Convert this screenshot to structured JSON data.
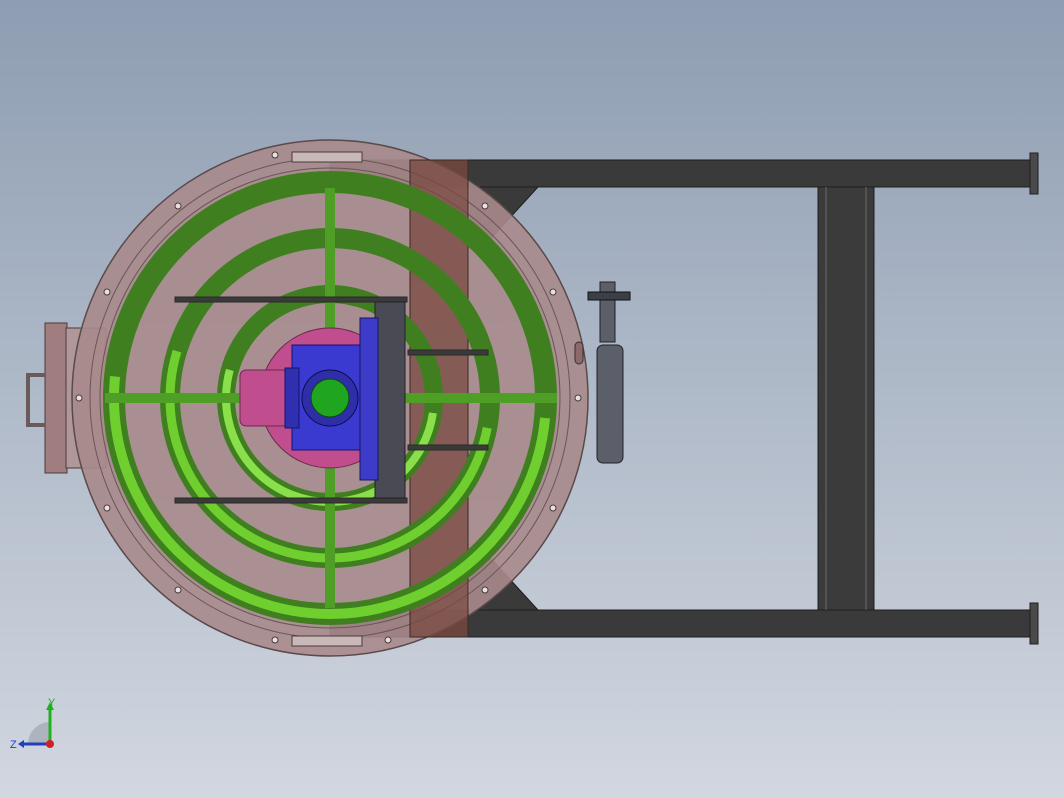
{
  "viewport": {
    "background_top": "#8e9db2",
    "background_bottom": "#d2d7e0"
  },
  "colors": {
    "housing": "#a88a8c",
    "housing_outline": "#5a4a4a",
    "rib_green_bright": "#6fcf2f",
    "rib_green_dark": "#3f7f1f",
    "frame": "#3a3a3a",
    "motor_blue": "#3a3ad0",
    "motor_center": "#1fa51f",
    "flange_pink": "#c04e8e",
    "bracket_brown": "#7a4a40",
    "valve_gray": "#5a5f6a"
  },
  "triad": {
    "y_label": "Y",
    "z_label": "Z",
    "y_color": "#20b020",
    "z_color": "#2040c0",
    "x_color": "#d02020"
  }
}
